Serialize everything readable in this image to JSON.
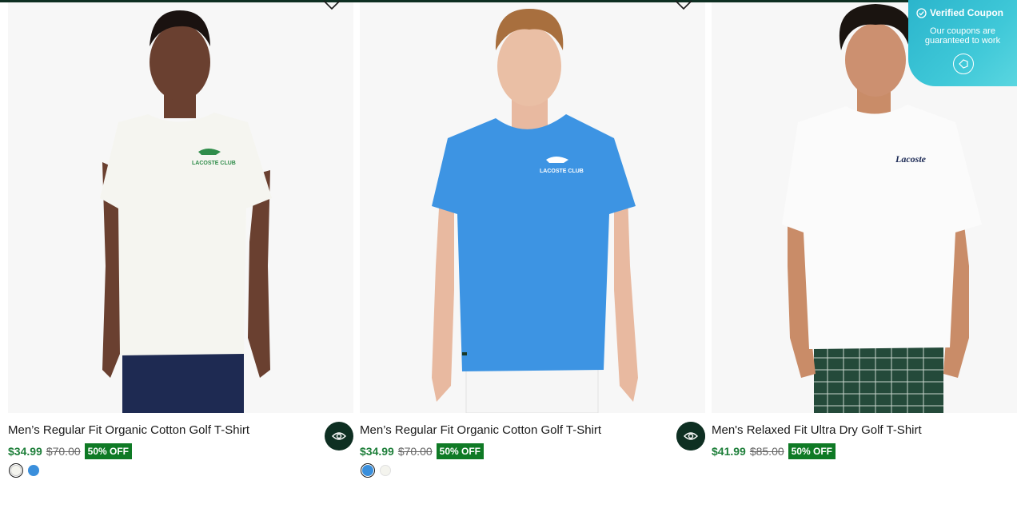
{
  "coupon": {
    "title": "Verified Coupon",
    "subtitle_line1": "Our coupons are",
    "subtitle_line2": "guaranteed to work"
  },
  "products": [
    {
      "title": "Men’s Regular Fit Organic Cotton Golf T-Shirt",
      "price": "$34.99",
      "original_price": "$70.00",
      "discount": "50% OFF",
      "swatches": [
        "#f4f4ee",
        "#3a8fdc"
      ],
      "selected_swatch": 0,
      "shirt_color": "#f5f5f0",
      "logo_text": "LACOSTE CLUB"
    },
    {
      "title": "Men’s Regular Fit Organic Cotton Golf T-Shirt",
      "price": "$34.99",
      "original_price": "$70.00",
      "discount": "50% OFF",
      "swatches": [
        "#3a8fdc",
        "#f4f4ee"
      ],
      "selected_swatch": 0,
      "shirt_color": "#3d94e3",
      "logo_text": "LACOSTE CLUB"
    },
    {
      "title": "Men's Relaxed Fit Ultra Dry Golf T-Shirt",
      "price": "$41.99",
      "original_price": "$85.00",
      "discount": "50% OFF",
      "swatches": [],
      "shirt_color": "#fbfbfb",
      "logo_text": "Lacoste"
    }
  ],
  "colors": {
    "brand_dark": "#0e2f22",
    "price_green": "#1e7f3a",
    "badge_green": "#0f7a25",
    "coupon_teal": "#3fc8d8"
  },
  "icons": {
    "wishlist": "heart-outline-icon",
    "quick_view": "eye-icon",
    "coupon_check": "check-circle-icon",
    "coupon_tag": "tag-icon"
  }
}
